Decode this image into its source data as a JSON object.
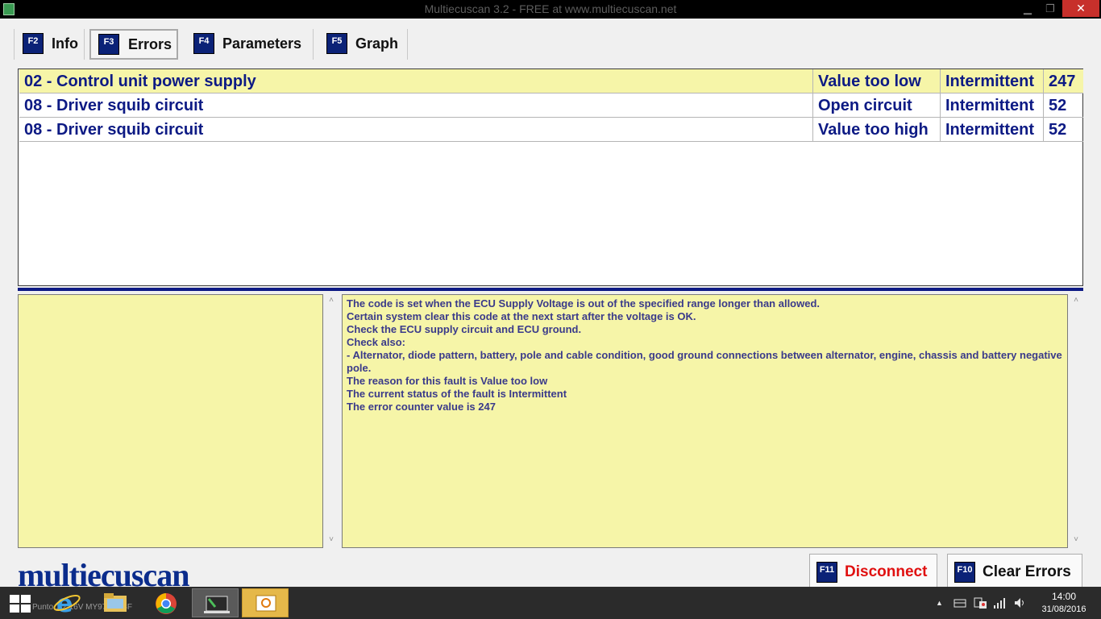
{
  "window": {
    "title": "Multiecuscan 3.2 - FREE at www.multiecuscan.net",
    "minimize": "▁",
    "maximize": "❐",
    "close": "✕"
  },
  "tabs": [
    {
      "key": "F2",
      "label": "Info"
    },
    {
      "key": "F3",
      "label": "Errors",
      "selected": true
    },
    {
      "key": "F4",
      "label": "Parameters"
    },
    {
      "key": "F5",
      "label": "Graph"
    }
  ],
  "errors": [
    {
      "code": "02 - Control unit power supply",
      "reason": "Value too low",
      "status": "Intermittent",
      "count": "247",
      "selected": true
    },
    {
      "code": "08 - Driver squib circuit",
      "reason": "Open circuit",
      "status": "Intermittent",
      "count": "52"
    },
    {
      "code": "08 - Driver squib circuit",
      "reason": "Value too high",
      "status": "Intermittent",
      "count": "52"
    }
  ],
  "description": [
    "The code is set when the ECU Supply Voltage is out of the specified range longer than allowed.",
    "Certain system clear this code at the next start after the voltage is OK.",
    "Check the ECU supply circuit and ECU ground.",
    "Check also:",
    "- Alternator, diode pattern, battery, pole and cable condition, good ground connections between alternator, engine, chassis and battery negative pole.",
    "The reason for this fault is Value too low",
    "The current status of the fault is Intermittent",
    "The error counter value is 247"
  ],
  "scroll": {
    "up": "˄",
    "down": "˅"
  },
  "logo": "multiecuscan",
  "buttons": {
    "disconnect": {
      "key": "F11",
      "label": "Disconnect"
    },
    "clear_errors": {
      "key": "F10",
      "label": "Clear Errors"
    }
  },
  "taskbar": {
    "ghost_text": "Punto 1.2 16V MY97 ag (3F",
    "tray_chevron": "▲",
    "time": "14:00",
    "date": "31/08/2016"
  },
  "colors": {
    "accent": "#0d1a84",
    "selected_row": "#f6f5a8",
    "disconnect": "#e01010"
  }
}
